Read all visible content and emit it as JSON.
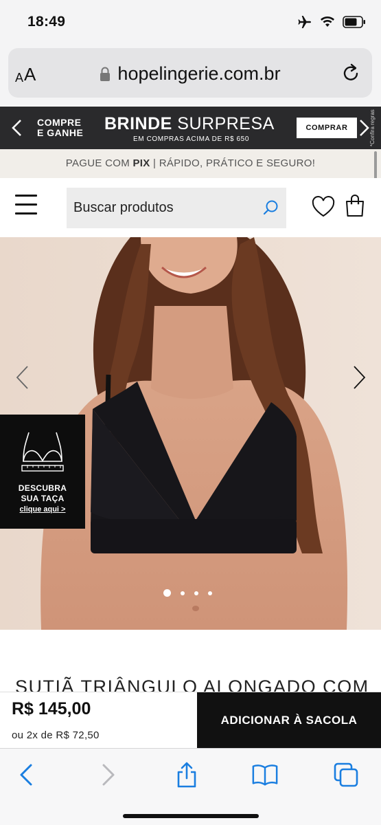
{
  "status": {
    "time": "18:49"
  },
  "browser": {
    "aa_label_small": "A",
    "aa_label_large": "A",
    "url": "hopelingerie.com.br"
  },
  "promo": {
    "left_text_line1": "COMPRE",
    "left_text_line2": "E GANHE",
    "title_bold": "BRINDE",
    "title_light": "SURPRESA",
    "subtitle": "EM COMPRAS ACIMA DE R$ 650",
    "button": "COMPRAR",
    "note": "*Confira regras"
  },
  "pix": {
    "prefix": "PAGUE COM ",
    "highlight": "PIX",
    "suffix": " | RÁPIDO, PRÁTICO E SEGURO!"
  },
  "header": {
    "search_placeholder": "Buscar produtos"
  },
  "hero": {
    "slides_total": 4,
    "active_slide": 1,
    "size_badge_title_line1": "DESCUBRA",
    "size_badge_title_line2": "SUA TAÇA",
    "size_badge_link": "clique aqui >"
  },
  "product": {
    "title": "SUTIÃ TRIÂNGULO ALONGADO COM",
    "price": "R$ 145,00",
    "installments": "ou  2x de  R$ 72,50",
    "add_to_bag": "ADICIONAR À SACOLA"
  },
  "colors": {
    "accent_blue": "#1a7ee0",
    "promo_bg": "#2a2a2c",
    "pix_bg": "#f1eee9",
    "safari_blue": "#1a7ee0"
  }
}
